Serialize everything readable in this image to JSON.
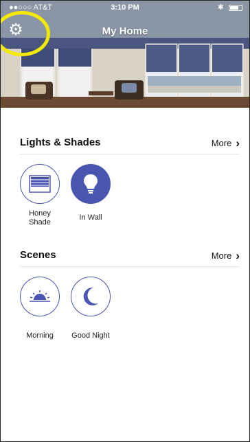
{
  "status": {
    "carrier": "●●○○○ AT&T",
    "time": "3:10 PM"
  },
  "header": {
    "title": "My Home"
  },
  "sections": {
    "lights": {
      "title": "Lights & Shades",
      "more_label": "More",
      "items": [
        {
          "label": "Honey Shade",
          "icon": "shade-icon",
          "active": false
        },
        {
          "label": "In Wall",
          "icon": "lightbulb-icon",
          "active": true
        }
      ]
    },
    "scenes": {
      "title": "Scenes",
      "more_label": "More",
      "items": [
        {
          "label": "Morning",
          "icon": "sunrise-icon"
        },
        {
          "label": "Good Night",
          "icon": "moon-icon"
        }
      ]
    }
  },
  "colors": {
    "accent": "#4a55b0",
    "highlight": "#f2ea00"
  }
}
